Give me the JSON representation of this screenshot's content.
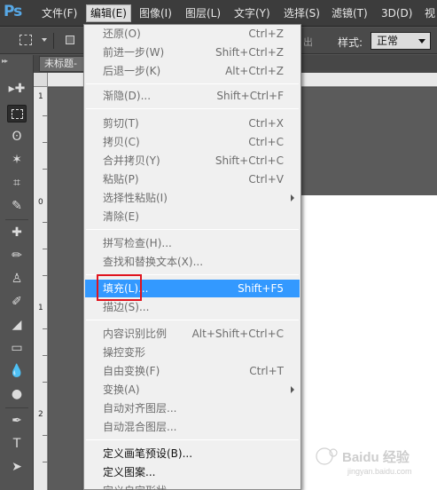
{
  "app": {
    "logo": "Ps"
  },
  "menubar": {
    "items": [
      {
        "label": "文件(F)",
        "active": false
      },
      {
        "label": "编辑(E)",
        "active": true
      },
      {
        "label": "图像(I)",
        "active": false
      },
      {
        "label": "图层(L)",
        "active": false
      },
      {
        "label": "文字(Y)",
        "active": false
      },
      {
        "label": "选择(S)",
        "active": false
      },
      {
        "label": "滤镜(T)",
        "active": false
      },
      {
        "label": "3D(D)",
        "active": false
      },
      {
        "label": "视",
        "active": false
      }
    ]
  },
  "options_bar": {
    "partial_text": "出",
    "style_label": "样式:",
    "style_value": "正常"
  },
  "document": {
    "tab_title": "未标题-",
    "ruler_numbers": [
      "1",
      "0",
      "1",
      "2"
    ]
  },
  "tools": [
    {
      "icon": "move-tool-icon",
      "glyph": "▸✚"
    },
    {
      "icon": "rect-marquee-tool-icon",
      "glyph": ""
    },
    {
      "icon": "lasso-tool-icon",
      "glyph": "ʘ"
    },
    {
      "icon": "magic-wand-tool-icon",
      "glyph": "✶"
    },
    {
      "icon": "crop-tool-icon",
      "glyph": "⌗"
    },
    {
      "icon": "eyedropper-tool-icon",
      "glyph": "✎"
    },
    {
      "icon": "healing-brush-tool-icon",
      "glyph": "✚"
    },
    {
      "icon": "brush-tool-icon",
      "glyph": "✏"
    },
    {
      "icon": "clone-stamp-tool-icon",
      "glyph": "♙"
    },
    {
      "icon": "history-brush-tool-icon",
      "glyph": "✐"
    },
    {
      "icon": "eraser-tool-icon",
      "glyph": "◢"
    },
    {
      "icon": "gradient-tool-icon",
      "glyph": "▭"
    },
    {
      "icon": "blur-tool-icon",
      "glyph": "💧"
    },
    {
      "icon": "dodge-tool-icon",
      "glyph": "●"
    },
    {
      "icon": "pen-tool-icon",
      "glyph": "✒"
    },
    {
      "icon": "type-tool-icon",
      "glyph": "T"
    },
    {
      "icon": "path-selection-tool-icon",
      "glyph": "➤"
    }
  ],
  "edit_menu": {
    "items": [
      {
        "label": "还原(O)",
        "shortcut": "Ctrl+Z",
        "state": "disabled"
      },
      {
        "label": "前进一步(W)",
        "shortcut": "Shift+Ctrl+Z",
        "state": "disabled"
      },
      {
        "label": "后退一步(K)",
        "shortcut": "Alt+Ctrl+Z",
        "state": "disabled"
      },
      {
        "label": "渐隐(D)...",
        "shortcut": "Shift+Ctrl+F",
        "state": "disabled"
      },
      {
        "label": "剪切(T)",
        "shortcut": "Ctrl+X",
        "state": "disabled"
      },
      {
        "label": "拷贝(C)",
        "shortcut": "Ctrl+C",
        "state": "disabled"
      },
      {
        "label": "合并拷贝(Y)",
        "shortcut": "Shift+Ctrl+C",
        "state": "disabled"
      },
      {
        "label": "粘贴(P)",
        "shortcut": "Ctrl+V",
        "state": "disabled"
      },
      {
        "label": "选择性粘贴(I)",
        "shortcut": "",
        "state": "disabled",
        "submenu": true
      },
      {
        "label": "清除(E)",
        "shortcut": "",
        "state": "disabled"
      },
      {
        "label": "拼写检查(H)...",
        "shortcut": "",
        "state": "disabled"
      },
      {
        "label": "查找和替换文本(X)...",
        "shortcut": "",
        "state": "disabled"
      },
      {
        "label": "填充(L)...",
        "shortcut": "Shift+F5",
        "state": "highlight"
      },
      {
        "label": "描边(S)...",
        "shortcut": "",
        "state": "disabled"
      },
      {
        "label": "内容识别比例",
        "shortcut": "Alt+Shift+Ctrl+C",
        "state": "disabled"
      },
      {
        "label": "操控变形",
        "shortcut": "",
        "state": "disabled"
      },
      {
        "label": "自由变换(F)",
        "shortcut": "Ctrl+T",
        "state": "disabled"
      },
      {
        "label": "变换(A)",
        "shortcut": "",
        "state": "disabled",
        "submenu": true
      },
      {
        "label": "自动对齐图层...",
        "shortcut": "",
        "state": "disabled"
      },
      {
        "label": "自动混合图层...",
        "shortcut": "",
        "state": "disabled"
      },
      {
        "label": "定义画笔预设(B)...",
        "shortcut": "",
        "state": "enabled"
      },
      {
        "label": "定义图案...",
        "shortcut": "",
        "state": "enabled"
      },
      {
        "label": "定义自定形状...",
        "shortcut": "",
        "state": "disabled"
      }
    ]
  },
  "watermark": {
    "text": "Baidu 经验",
    "subtext": "jingyan.baidu.com"
  },
  "colors": {
    "highlight": "#3399ff",
    "annotation_box": "#e0141e",
    "logo": "#57a8e6"
  }
}
